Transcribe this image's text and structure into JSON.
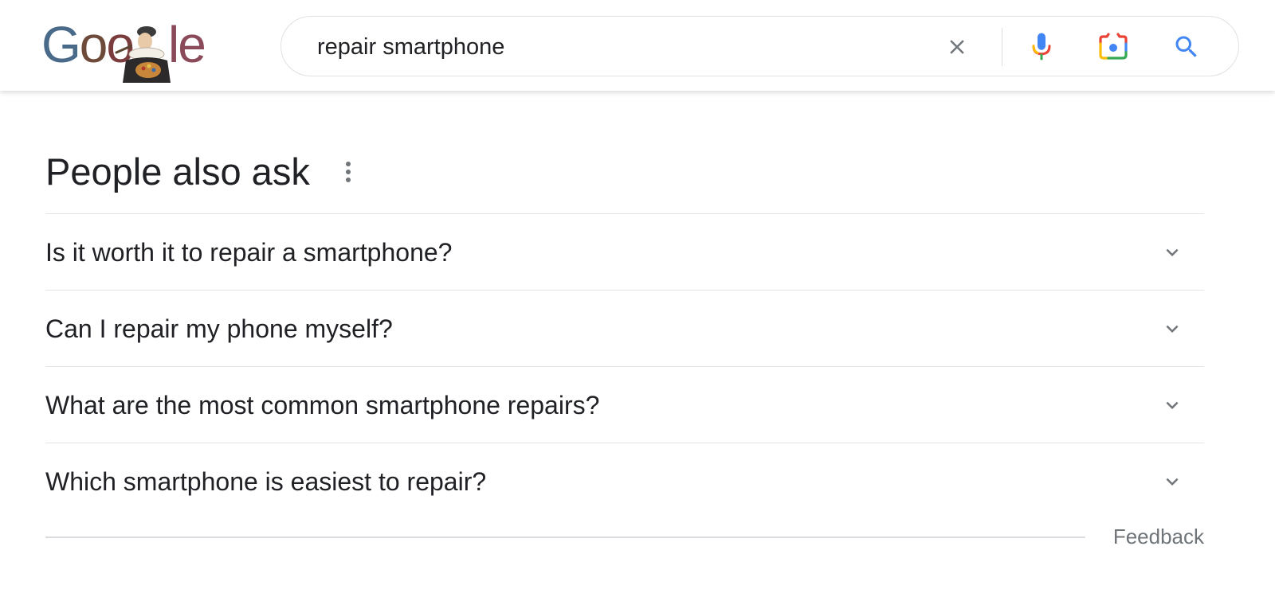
{
  "header": {
    "logo_text": "Google",
    "search": {
      "value": "repair smartphone",
      "placeholder": ""
    },
    "icons": {
      "clear": "close-icon",
      "voice": "microphone-icon",
      "image": "camera-lens-icon",
      "search": "search-icon"
    }
  },
  "people_also_ask": {
    "title": "People also ask",
    "menu_icon": "more-vert-icon",
    "questions": [
      {
        "text": "Is it worth it to repair a smartphone?"
      },
      {
        "text": "Can I repair my phone myself?"
      },
      {
        "text": "What are the most common smartphone repairs?"
      },
      {
        "text": "Which smartphone is easiest to repair?"
      }
    ],
    "feedback_label": "Feedback"
  },
  "colors": {
    "text": "#202124",
    "secondary_text": "#70757a",
    "divider": "#e3e3e3",
    "google_blue": "#4285f4",
    "google_red": "#ea4335",
    "google_yellow": "#fbbc05",
    "google_green": "#34a853"
  }
}
